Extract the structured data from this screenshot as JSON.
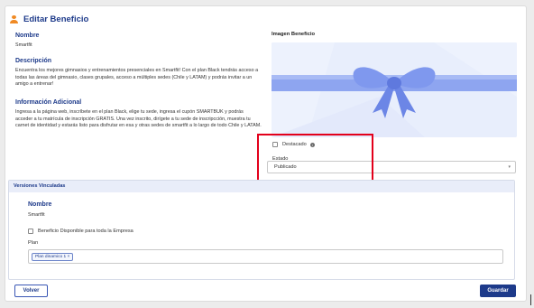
{
  "page": {
    "title": "Editar Beneficio"
  },
  "nombre": {
    "label": "Nombre",
    "value": "Smartfit"
  },
  "descripcion": {
    "label": "Descripción",
    "value": "Encuentra los mejores gimnasios y entrenamientos presenciales en Smartfit! Con el plan Black tendrás acceso a todas las áreas del gimnasio, clases grupales, acceso a múltiples sedes (Chile y LATAM) y podrás invitar a un amigo a entrenar!"
  },
  "informacion": {
    "label": "Información Adicional",
    "value": "Ingresa a la página web, inscríbete en el plan Black, elige tu sede, ingresa el cupón SMARTBUK y podrás acceder a tu matrícula de inscripción GRATIS. Una vez inscrito, dirígete a tu sede de inscripcción, muestra tu carnet de identidad y estarás listo para disfrutar en esa y otras sedes de smartfit a lo largo de todo Chile y LATAM."
  },
  "imagen": {
    "label": "Imagen Beneficio",
    "icon": "gift-bow-image"
  },
  "destacado": {
    "label": "Destacado",
    "checked": false,
    "icon": "info-icon"
  },
  "estado": {
    "label": "Estado",
    "value": "Publicado",
    "icon": "chevron-down-icon"
  },
  "versiones": {
    "title": "Versiones Vinculadas",
    "nombre_label": "Nombre",
    "nombre_value": "Smartfit",
    "disponible_label": "Beneficio Disponible para toda la Empresa",
    "disponible_checked": false,
    "plan_label": "Plan",
    "plan_chip": "Plan dinamico 1 ×"
  },
  "actions": {
    "back_label": "Volver",
    "save_label": "Guardar"
  },
  "colors": {
    "primary": "#1d3a8a",
    "accent": "#f08a24",
    "highlight": "#e3001b",
    "image_bg": "#e8eefc",
    "ribbon": "#7f98ee"
  }
}
